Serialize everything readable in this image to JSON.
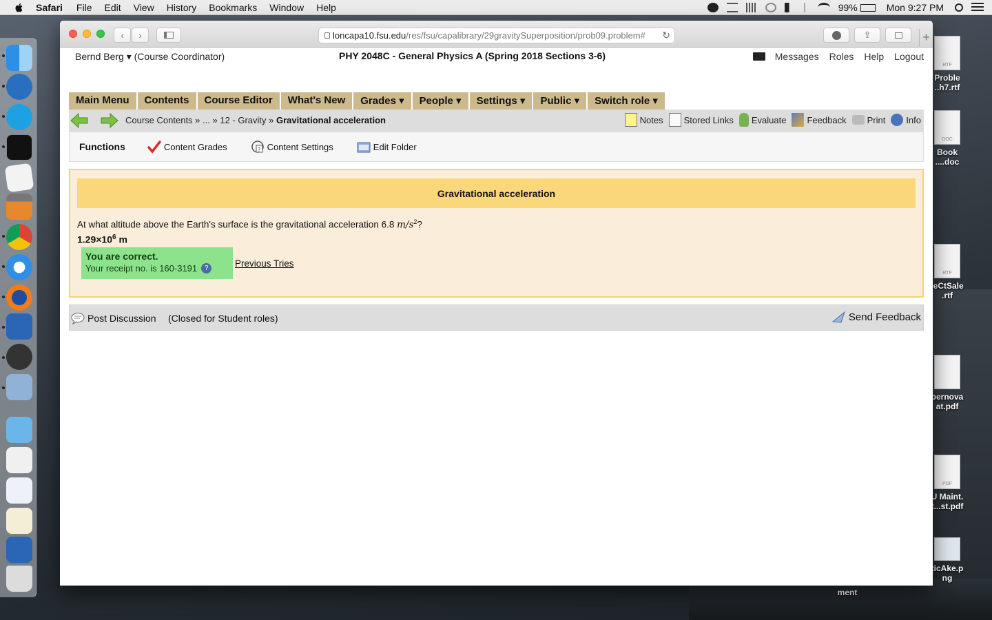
{
  "menubar": {
    "app": "Safari",
    "items": [
      "File",
      "Edit",
      "View",
      "History",
      "Bookmarks",
      "Window",
      "Help"
    ],
    "battery": "99%",
    "clock": "Mon 9:27 PM"
  },
  "desktop": {
    "files": [
      {
        "name": "Proble\n..h7.rtf",
        "type": "RTF"
      },
      {
        "name": "Book\n....doc",
        "type": "DOC"
      },
      {
        "name": "ieCtSale\n.rtf",
        "type": "RTF"
      },
      {
        "name": "pernova\nat.pdf",
        "type": ""
      },
      {
        "name": "U Maint.\nt...st.pdf",
        "type": "PDF"
      },
      {
        "name": "ticAke.p\nng",
        "type": ""
      },
      {
        "name": "ment",
        "type": ""
      }
    ]
  },
  "browser": {
    "url_host": "loncapa10.fsu.edu",
    "url_path": "/res/fsu/capalibrary/29gravitySuperposition/prob09.problem#"
  },
  "header": {
    "user": "Bernd Berg ▾",
    "role": "(Course Coordinator)",
    "course": "PHY 2048C - General Physics A (Spring 2018 Sections 3-6)",
    "links": {
      "messages": "Messages",
      "roles": "Roles",
      "help": "Help",
      "logout": "Logout"
    }
  },
  "mainmenu": {
    "items": [
      "Main Menu",
      "Contents",
      "Course Editor",
      "What's New",
      "Grades ▾",
      "People ▾",
      "Settings ▾",
      "Public ▾",
      "Switch role ▾"
    ]
  },
  "breadcrumb": {
    "part1": "Course Contents »",
    "part2": "... »",
    "part3": "12 - Gravity »",
    "current": "Gravitational acceleration",
    "tools": {
      "notes": "Notes",
      "stored_links": "Stored Links",
      "evaluate": "Evaluate",
      "feedback": "Feedback",
      "print": "Print",
      "info": "Info"
    }
  },
  "functions": {
    "title": "Functions",
    "items": {
      "content_grades": "Content Grades",
      "content_settings": "Content Settings",
      "edit_folder": "Edit Folder"
    }
  },
  "problem": {
    "title": "Gravitational acceleration",
    "question_text": "At what altitude above the Earth's surface is the gravitational acceleration 6.8",
    "unit_base": "m/s",
    "unit_exp": "2",
    "question_end": "?",
    "answer_mantissa": "1.29×10",
    "answer_exp": "6",
    "answer_unit": "m",
    "status_title": "You are correct.",
    "receipt": "Your receipt no. is 160-3191",
    "previous_tries": "Previous Tries"
  },
  "discussion": {
    "post": "Post Discussion",
    "closed": "(Closed for Student roles)",
    "send_feedback": "Send Feedback"
  },
  "colors": {
    "menu_bg": "#ccb98c",
    "problem_header": "#fad77a",
    "problem_bg": "#faeedb",
    "correct_bg": "#8ce38c"
  }
}
